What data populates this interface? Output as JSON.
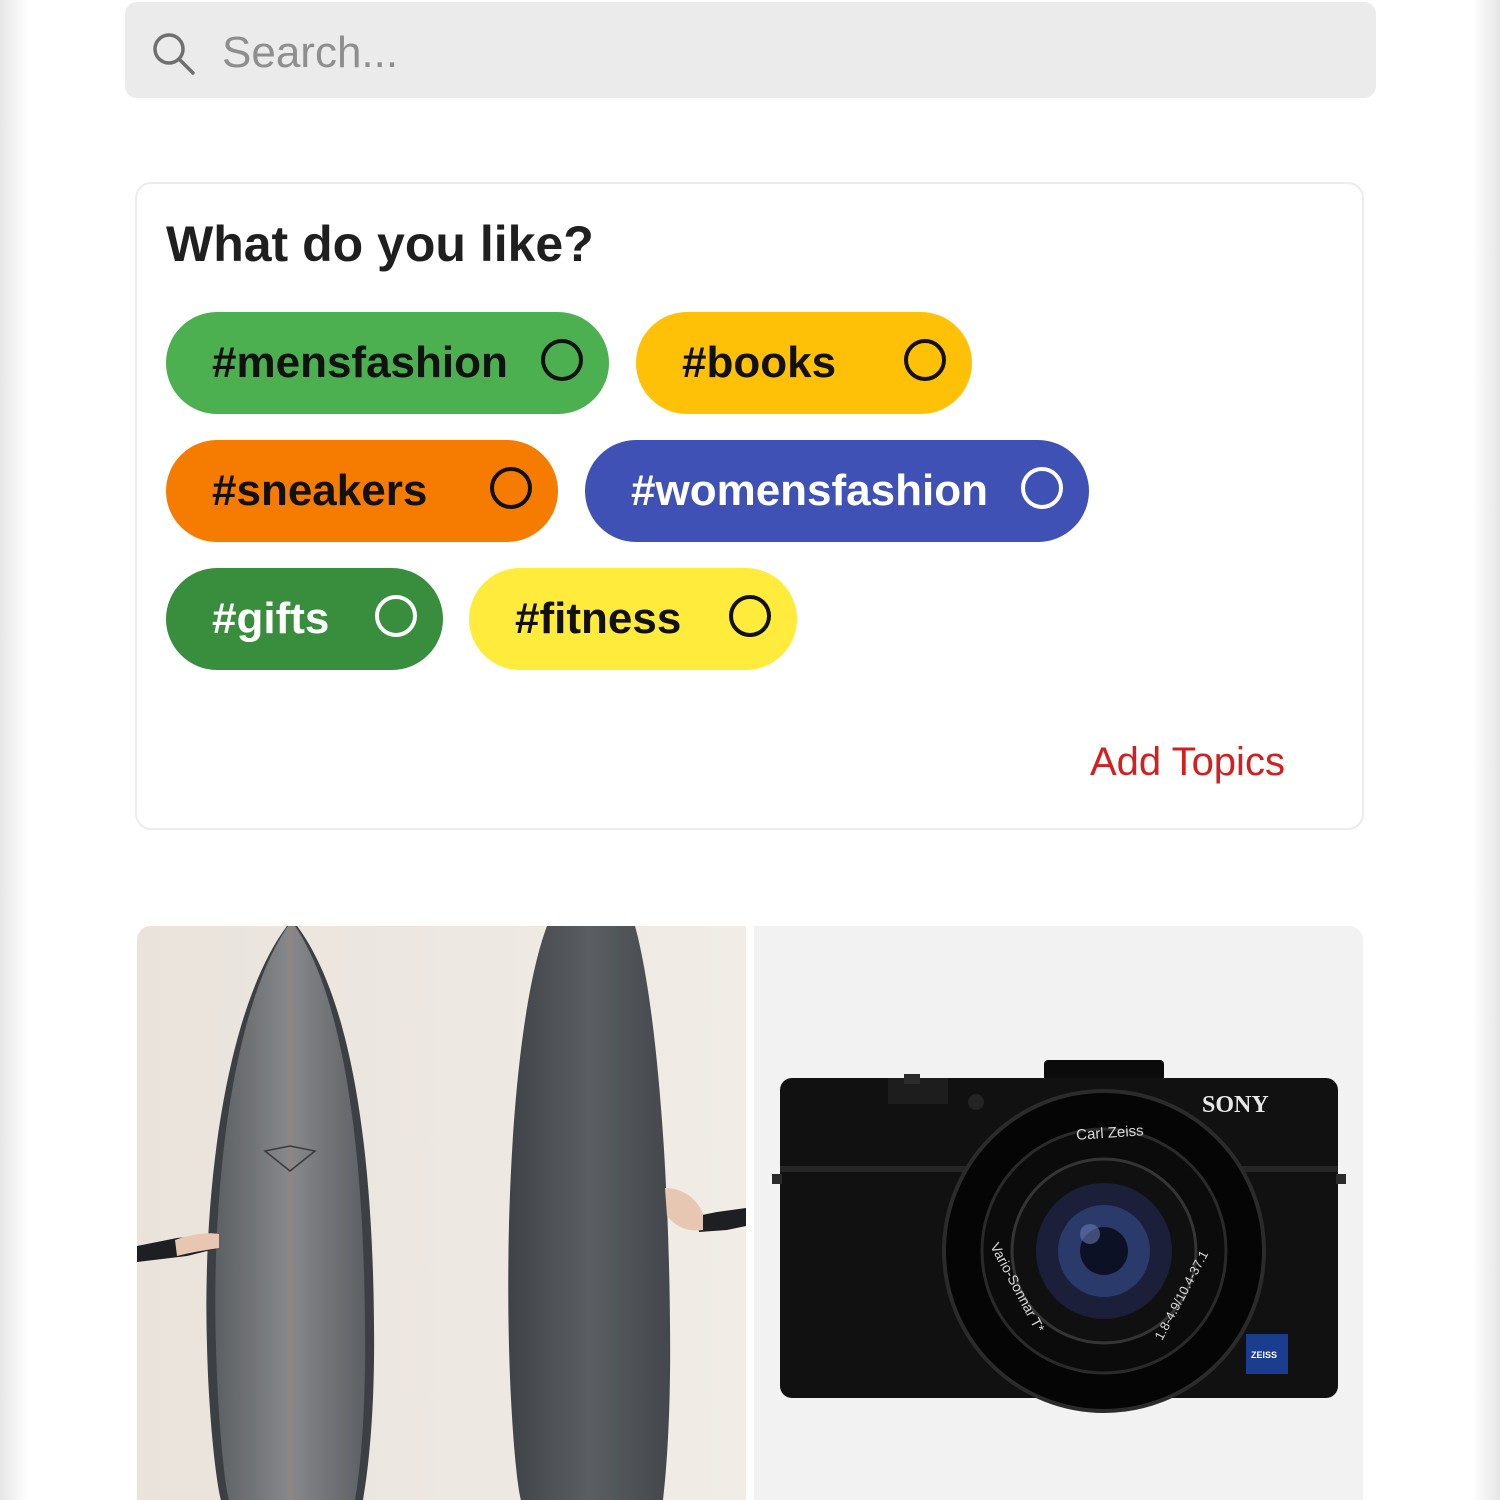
{
  "search": {
    "placeholder": "Search...",
    "icon": "search-icon"
  },
  "topics": {
    "title": "What do you like?",
    "chips": [
      {
        "label": "#mensfashion",
        "bg": "#4caf50",
        "fg": "#111111"
      },
      {
        "label": "#books",
        "bg": "#ffc107",
        "fg": "#111111"
      },
      {
        "label": "#sneakers",
        "bg": "#f57c00",
        "fg": "#111111"
      },
      {
        "label": "#womensfashion",
        "bg": "#3f51b5",
        "fg": "#ffffff"
      },
      {
        "label": "#gifts",
        "bg": "#388e3c",
        "fg": "#ffffff"
      },
      {
        "label": "#fitness",
        "bg": "#ffeb3b",
        "fg": "#111111"
      }
    ],
    "add_label": "Add Topics",
    "add_color": "#d21f1f"
  },
  "feed": {
    "items": [
      {
        "icon": "surfboards-image"
      },
      {
        "icon": "camera-image",
        "brand": "SONY",
        "lens_brand": "Carl Zeiss",
        "lens_model": "Vario-Sonnar T*",
        "lens_spec": "1.8-4.9/10.4-37.1",
        "badge": "ZEISS"
      }
    ]
  }
}
